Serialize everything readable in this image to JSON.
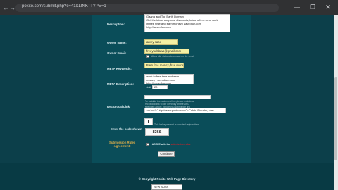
{
  "browser": {
    "url": "pokito.com/submit.php?c=41&LINK_TYPE=1",
    "back_icon": "arrow-left",
    "forward_icon": "arrow-right",
    "minimize": "—",
    "restore": "❐",
    "close": "✕"
  },
  "form": {
    "description": {
      "label": "Description:",
      "value": "Gaana and Top Earth Domain\nGet the latest coupons, discounts, latest offers.. and work\nin free time and earn money | savedfun.com\nhttp://savedfun.com"
    },
    "owner_name": {
      "label": "Owner Name:",
      "value": "arvey sabo"
    },
    "owner_email": {
      "label": "Owner Email:",
      "value": "freeyueblaws@gmail.com",
      "checkbox_hint": "Allow site visitors to contact me by email"
    },
    "meta_keywords": {
      "label": "META Keywords:",
      "value": "Earn free money, free money"
    },
    "meta_description": {
      "label": "META Description:",
      "value": "work in free time and earn\nmoney | savedfun.com\nhttp://savedfun.com",
      "limit_label": "Limit:",
      "limit_value": "20"
    },
    "reciprocal_link": {
      "label": "Reciprocal Link:",
      "note": "To validate the reciprocal link please include a\nreciprocal link to our directory on the URL\nspecified above, before you submit the link",
      "code": "<a href=\"http://www.pokito.com/\">Pokito Directory</a>"
    },
    "captcha": {
      "label": "Enter the code shown",
      "hint": "This helps prevent automated registrations.",
      "code": "836S"
    },
    "terms": {
      "label": "Submission Rules\nAgreement:",
      "text": "I AGREE with the",
      "link": "submission rules"
    },
    "continue_label": "Continue"
  },
  "footer": {
    "copyright": "© Copyright Pokito Web Page Directory",
    "select_value": "NEW SUBS"
  },
  "colors": {
    "page_bg": "#0c3f4a",
    "panel_bg": "#0a4d59",
    "highlight_field": "#f5f0a3",
    "link_red": "#c2272d"
  }
}
